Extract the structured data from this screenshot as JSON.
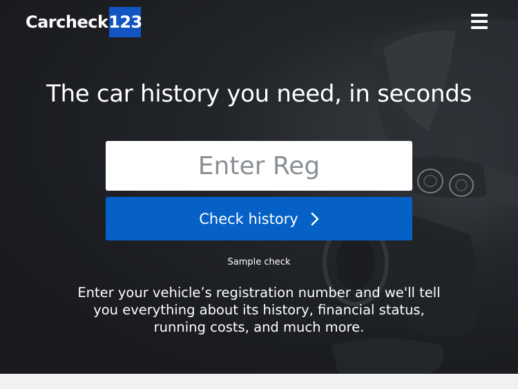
{
  "header": {
    "logo_text": "Carcheck",
    "logo_number": "123",
    "logo_number_bg": "#1255c2",
    "menu_icon": "hamburger-menu-icon"
  },
  "hero": {
    "headline": "The car history you need, in seconds",
    "reg_input": {
      "placeholder": "Enter Reg",
      "value": ""
    },
    "check_button": {
      "label": "Check history",
      "icon": "chevron-right-icon",
      "color": "#0561c6"
    },
    "sample_link": "Sample check",
    "description": "Enter your vehicle’s registration number and we'll tell you everything about its history, financial status, running costs, and much more."
  }
}
